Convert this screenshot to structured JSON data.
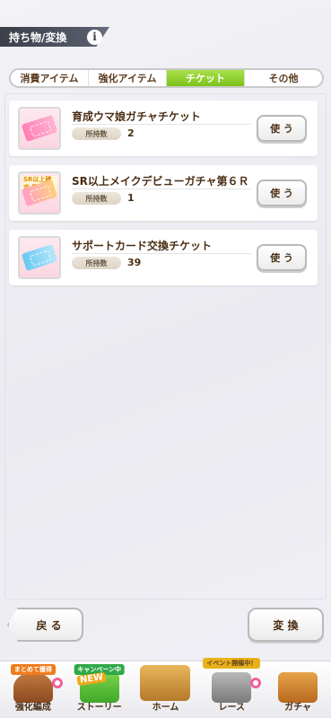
{
  "header": {
    "title": "持ち物/変換"
  },
  "tabs": [
    {
      "label": "消費アイテム",
      "active": false
    },
    {
      "label": "強化アイテム",
      "active": false
    },
    {
      "label": "チケット",
      "active": true
    },
    {
      "label": "その他",
      "active": false
    }
  ],
  "owned_label": "所持数",
  "use_label": "使 う",
  "items": [
    {
      "name": "育成ウマ娘ガチャチケット",
      "owned": "2",
      "icon": "pink-ticket-icon"
    },
    {
      "name": "SR以上メイクデビューガチャ第６Ｒ",
      "owned": "1",
      "icon": "sr-ticket-icon",
      "badge": "SR以上確定 第６R"
    },
    {
      "name": "サポートカード交換チケット",
      "owned": "39",
      "icon": "blue-ticket-icon"
    }
  ],
  "footer": {
    "back_label": "戻 る",
    "exchange_label": "変 換"
  },
  "nav": [
    {
      "label": "強化編成",
      "tag": "まとめて獲得"
    },
    {
      "label": "ストーリー",
      "tag": "キャンペーン中",
      "badge": "NEW"
    },
    {
      "label": "ホーム"
    },
    {
      "label": "レース",
      "tag": "イベント開催中！"
    },
    {
      "label": "ガチャ"
    }
  ],
  "colors": {
    "active_tab": "#7cc21c",
    "title_bar": "#3b3f4a"
  }
}
